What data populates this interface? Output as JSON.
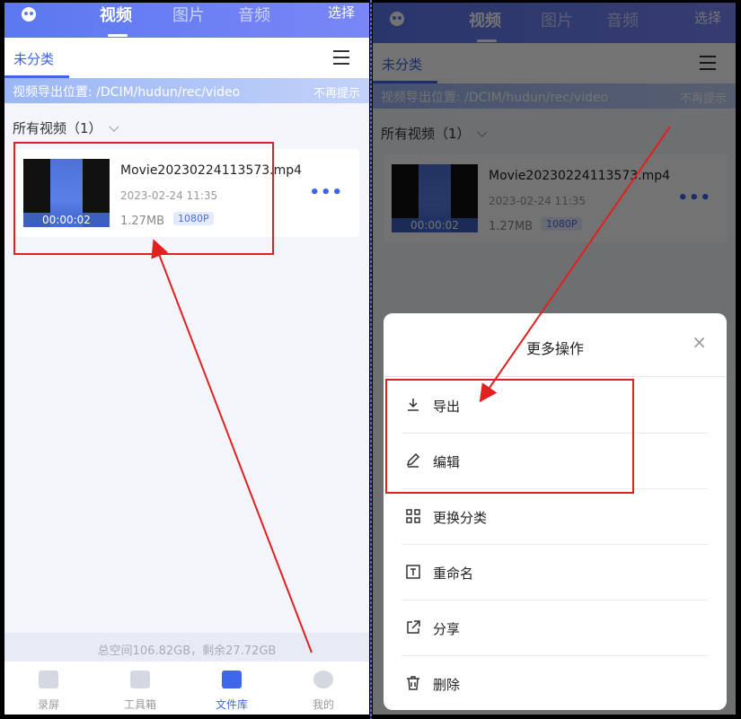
{
  "header": {
    "tabs": [
      "视频",
      "图片",
      "音频"
    ],
    "select_label": "选择"
  },
  "category": {
    "label": "未分类"
  },
  "export_banner": {
    "text": "视频导出位置: /DCIM/hudun/rec/video",
    "dismiss": "不再提示"
  },
  "section": {
    "title": "所有视频（1）"
  },
  "video": {
    "filename": "Movie20230224113573.mp4",
    "date": "2023-02-24   11:35",
    "size": "1.27MB",
    "resolution": "1080P",
    "duration": "00:00:02",
    "more": "•••"
  },
  "storage": {
    "text": "总空间106.82GB，剩余27.72GB"
  },
  "nav": {
    "items": [
      "录屏",
      "工具箱",
      "文件库",
      "我的"
    ],
    "active_index": 2
  },
  "sheet": {
    "title": "更多操作",
    "close": "×",
    "actions": [
      {
        "label": "导出",
        "icon": "download-icon"
      },
      {
        "label": "编辑",
        "icon": "pencil-icon"
      },
      {
        "label": "更换分类",
        "icon": "grid-icon"
      },
      {
        "label": "重命名",
        "icon": "text-box-icon"
      },
      {
        "label": "分享",
        "icon": "share-icon"
      },
      {
        "label": "删除",
        "icon": "trash-icon"
      }
    ]
  },
  "colors": {
    "accent": "#3d66ea",
    "annotation": "#e0211f"
  }
}
